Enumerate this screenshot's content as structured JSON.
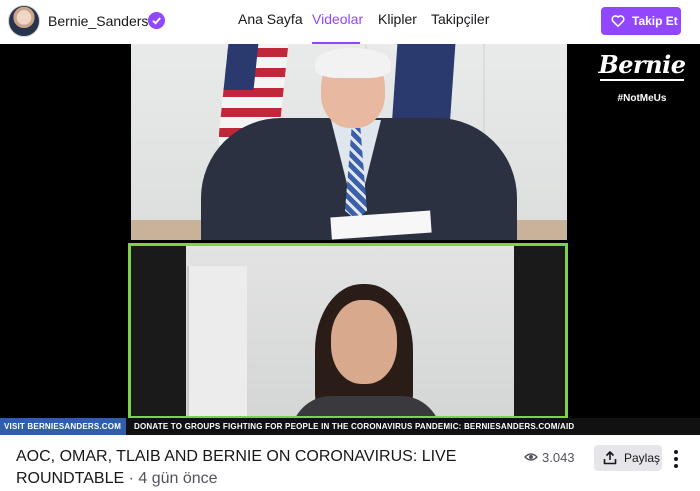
{
  "channel": {
    "name": "Bernie_Sanders",
    "verified_icon": "verified-check-icon",
    "avatar_icon": "channel-avatar"
  },
  "nav": {
    "tabs": [
      {
        "label": "Ana Sayfa",
        "active": false
      },
      {
        "label": "Videolar",
        "active": true
      },
      {
        "label": "Klipler",
        "active": false
      },
      {
        "label": "Takipçiler",
        "active": false
      }
    ]
  },
  "follow_button": {
    "label": "Takip Et",
    "icon": "heart-icon"
  },
  "video": {
    "overlay_logo": "Bernie",
    "overlay_hashtag": "#NotMeUs",
    "banner_left": "VISIT BERNIESANDERS.COM",
    "banner_right": "DONATE TO GROUPS FIGHTING FOR PEOPLE IN THE CORONAVIRUS PANDEMIC: BERNIESANDERS.COM/AID"
  },
  "info": {
    "title": "AOC, OMAR, TLAIB AND BERNIE ON CORONAVIRUS: LIVE ROUNDTABLE",
    "separator": " · ",
    "age": "4 gün önce",
    "view_count": "3.043",
    "views_icon": "eye-icon",
    "share_label": "Paylaş",
    "share_icon": "share-upload-icon",
    "more_icon": "more-vertical-icon"
  },
  "colors": {
    "accent": "#9147ff",
    "speaker_border": "#7cd34a",
    "banner_blue": "#2f5fa8"
  }
}
